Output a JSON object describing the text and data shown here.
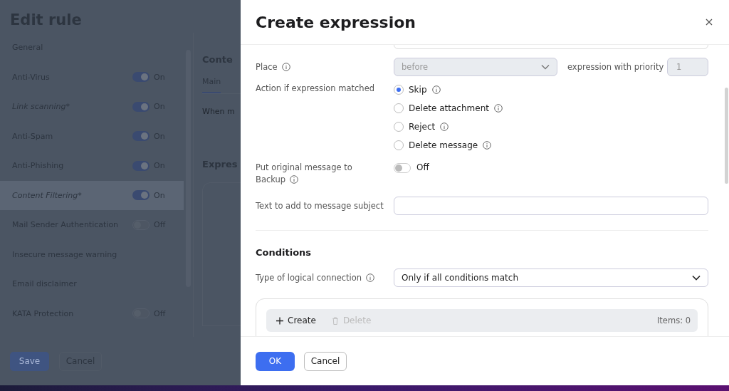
{
  "page": {
    "title": "Edit rule",
    "sidebar": [
      {
        "label": "General",
        "modified": false,
        "selected": false
      },
      {
        "label": "Anti-Virus",
        "modified": false,
        "selected": false,
        "toggle": {
          "on": true,
          "label": "On"
        }
      },
      {
        "label": "Link scanning*",
        "modified": true,
        "selected": false,
        "toggle": {
          "on": true,
          "label": "On"
        }
      },
      {
        "label": "Anti-Spam",
        "modified": false,
        "selected": false,
        "toggle": {
          "on": true,
          "label": "On"
        }
      },
      {
        "label": "Anti-Phishing",
        "modified": false,
        "selected": false,
        "toggle": {
          "on": true,
          "label": "On"
        }
      },
      {
        "label": "Content Filtering*",
        "modified": true,
        "selected": true,
        "toggle": {
          "on": true,
          "label": "On"
        }
      },
      {
        "label": "Mail Sender Authentication",
        "modified": false,
        "selected": false,
        "toggle": {
          "on": false,
          "label": "Off"
        }
      },
      {
        "label": "Insecure message warning",
        "modified": false,
        "selected": false
      },
      {
        "label": "Email disclaimer",
        "modified": false,
        "selected": false
      },
      {
        "label": "KATA Protection",
        "modified": false,
        "selected": false,
        "toggle": {
          "on": false,
          "label": "Off"
        }
      }
    ],
    "content_title": "Conte",
    "tabs": [
      {
        "label": "Main",
        "selected": true
      }
    ],
    "description": "When m",
    "section": "Expres",
    "save": "Save",
    "cancel": "Cancel"
  },
  "dialog": {
    "title": "Create expression",
    "place": {
      "label": "Place",
      "value": "before",
      "disabled": true
    },
    "priority": {
      "label": "expression with priority",
      "value": "1"
    },
    "action": {
      "label": "Action if expression matched",
      "options": [
        {
          "label": "Skip",
          "selected": true
        },
        {
          "label": "Delete attachment",
          "selected": false
        },
        {
          "label": "Reject",
          "selected": false
        },
        {
          "label": "Delete message",
          "selected": false
        }
      ]
    },
    "backup": {
      "label": "Put original message to Backup",
      "on": false,
      "state": "Off"
    },
    "subject": {
      "label": "Text to add to message subject"
    },
    "conditions": {
      "heading": "Conditions",
      "logic_label": "Type of logical connection",
      "logic_value": "Only if all conditions match",
      "create": "Create",
      "delete": "Delete",
      "delete_disabled": true,
      "count": "Items: 0"
    },
    "ok": "OK",
    "cancel": "Cancel"
  }
}
